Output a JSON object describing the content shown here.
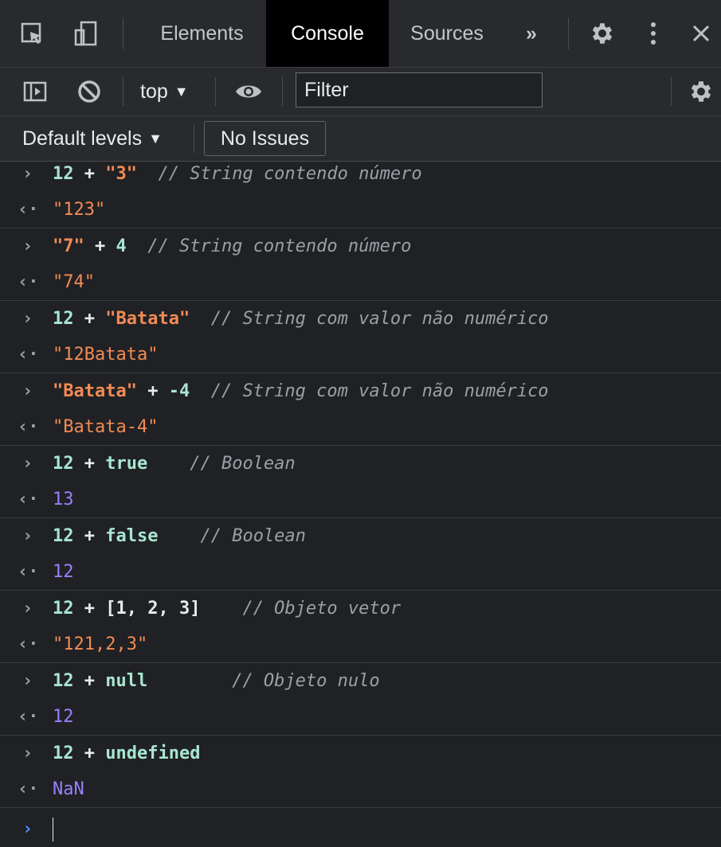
{
  "devtools": {
    "tabs": [
      "Elements",
      "Console",
      "Sources"
    ],
    "active_tab": "Console",
    "more_tabs_icon": "»",
    "context_label": "top",
    "filter_placeholder": "Filter",
    "levels_label": "Default levels",
    "issues_label": "No Issues",
    "colors": {
      "number": "#9cdcfe",
      "string": "#f28b54",
      "result_number": "#9980ff",
      "comment": "#9aa0a6"
    }
  },
  "console": {
    "entries": [
      {
        "input": [
          [
            "12",
            "num"
          ],
          [
            " + ",
            "op"
          ],
          [
            "\"3\"",
            "str"
          ],
          [
            "  // String contendo número",
            "com"
          ]
        ],
        "output": [
          [
            "\"123\"",
            "res-str"
          ]
        ]
      },
      {
        "input": [
          [
            "\"7\"",
            "str"
          ],
          [
            " + ",
            "op"
          ],
          [
            "4",
            "num"
          ],
          [
            "  // String contendo número",
            "com"
          ]
        ],
        "output": [
          [
            "\"74\"",
            "res-str"
          ]
        ]
      },
      {
        "input": [
          [
            "12",
            "num"
          ],
          [
            " + ",
            "op"
          ],
          [
            "\"Batata\"",
            "str"
          ],
          [
            "  // String com valor não numérico",
            "com"
          ]
        ],
        "output": [
          [
            "\"12Batata\"",
            "res-str"
          ]
        ]
      },
      {
        "input": [
          [
            "\"Batata\"",
            "str"
          ],
          [
            " + ",
            "op"
          ],
          [
            "-4",
            "num"
          ],
          [
            "  // String com valor não numérico",
            "com"
          ]
        ],
        "output": [
          [
            "\"Batata-4\"",
            "res-str"
          ]
        ]
      },
      {
        "input": [
          [
            "12",
            "num"
          ],
          [
            " + ",
            "op"
          ],
          [
            "true",
            "kw"
          ],
          [
            "    // Boolean",
            "com"
          ]
        ],
        "output": [
          [
            "13",
            "res-num"
          ]
        ]
      },
      {
        "input": [
          [
            "12",
            "num"
          ],
          [
            " + ",
            "op"
          ],
          [
            "false",
            "kw"
          ],
          [
            "    // Boolean",
            "com"
          ]
        ],
        "output": [
          [
            "12",
            "res-num"
          ]
        ]
      },
      {
        "input": [
          [
            "12",
            "num"
          ],
          [
            " + ",
            "op"
          ],
          [
            "[1, 2, 3]",
            "op"
          ],
          [
            "    // Objeto vetor",
            "com"
          ]
        ],
        "output": [
          [
            "\"121,2,3\"",
            "res-str"
          ]
        ]
      },
      {
        "input": [
          [
            "12",
            "num"
          ],
          [
            " + ",
            "op"
          ],
          [
            "null",
            "kw"
          ],
          [
            "        // Objeto nulo",
            "com"
          ]
        ],
        "output": [
          [
            "12",
            "res-num"
          ]
        ]
      },
      {
        "input": [
          [
            "12",
            "num"
          ],
          [
            " + ",
            "op"
          ],
          [
            "undefined",
            "kw"
          ]
        ],
        "output": [
          [
            "NaN",
            "res-num"
          ]
        ]
      }
    ]
  }
}
